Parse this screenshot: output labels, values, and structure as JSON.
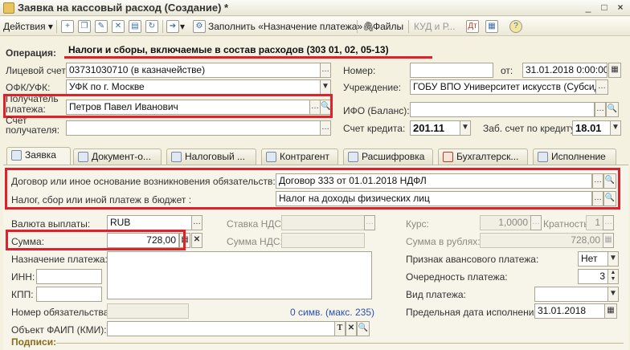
{
  "window": {
    "title": "Заявка на кассовый расход (Создание) *",
    "minimize": "_",
    "maximize": "□",
    "close": "×"
  },
  "toolbar": {
    "actions": "Действия",
    "fill": "Заполнить «Назначение платежа»",
    "files": "Файлы",
    "kud": "КУД и Р..."
  },
  "header": {
    "operation_label": "Операция:",
    "operation_value": "Налоги и сборы, включаемые в состав расходов (303 01, 02, 05-13)",
    "account_label": "Лицевой счет:",
    "account_value": "03731030710 (в казначействе)",
    "ofk_label": "ОФК/УФК:",
    "ofk_value": "УФК по г. Москве",
    "recipient_label_1": "Получатель",
    "recipient_label_2": "платежа:",
    "recipient_value": "Петров Павел Иванович",
    "recipient_account_label_1": "Счет",
    "recipient_account_label_2": "получателя:",
    "number_label": "Номер:",
    "number_value": "",
    "date_label": "от:",
    "date_value": "31.01.2018  0:00:00",
    "institution_label": "Учреждение:",
    "institution_value": "ГОБУ ВПО Университет искусств (Субсидия)",
    "ifo_label": "ИФО (Баланс):",
    "credit_account_label": "Счет кредита:",
    "credit_account_value": "201.11",
    "zab_label": "Заб. счет по кредиту:",
    "zab_value": "18.01"
  },
  "tabs": [
    {
      "label": "Заявка"
    },
    {
      "label": "Документ-о..."
    },
    {
      "label": "Налоговый ..."
    },
    {
      "label": "Контрагент"
    },
    {
      "label": "Расшифровка"
    },
    {
      "label": "Бухгалтерск..."
    },
    {
      "label": "Исполнение"
    }
  ],
  "main": {
    "contract_label": "Договор или иное основание возникновения обязательств:",
    "contract_value": "Договор 333 от 01.01.2018  НДФЛ",
    "tax_label": "Налог, сбор или иной платеж в бюджет :",
    "tax_value": "Налог на доходы физических лиц",
    "currency_label": "Валюта выплаты:",
    "currency_value": "RUB",
    "vat_rate_label": "Ставка НДС:",
    "rate_label": "Курс:",
    "rate_value": "1,0000",
    "multiplicity_label": "Кратность:",
    "multiplicity_value": "1",
    "sum_label": "Сумма:",
    "sum_value": "728,00",
    "vat_sum_label": "Сумма НДС:",
    "sum_rub_label": "Сумма в рублях:",
    "sum_rub_value": "728,00",
    "purpose_label": "Назначение платежа:",
    "inn_label": "ИНН:",
    "kpp_label": "КПП:",
    "advance_label": "Признак авансового платежа:",
    "advance_value": "Нет",
    "priority_label": "Очередность платежа:",
    "priority_value": "3",
    "payment_type_label": "Вид платежа:",
    "obligation_label": "Номер обязательства:",
    "char_count": "0 симв. (макс. 235)",
    "deadline_label": "Предельная дата исполнения:",
    "deadline_value": "31.01.2018",
    "faip_label": "Объект ФАИП (КМИ):",
    "signatures_label": "Подписи:"
  },
  "colors": {
    "highlight": "#e0202a",
    "background": "#f4f1e0",
    "link": "#2a4fb0"
  }
}
